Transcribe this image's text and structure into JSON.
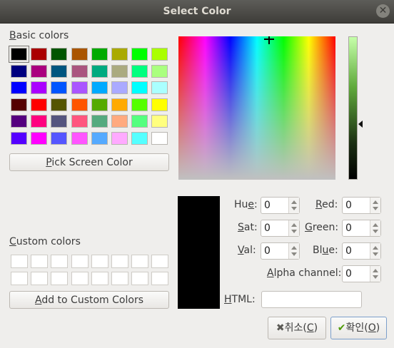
{
  "window": {
    "title": "Select Color"
  },
  "basic": {
    "label_mnemonic": "B",
    "label_rest": "asic colors",
    "swatches": [
      "#000000",
      "#aa0000",
      "#005500",
      "#aa5500",
      "#00aa00",
      "#aaaa00",
      "#00ff00",
      "#aaff00",
      "#00007f",
      "#aa007f",
      "#00557f",
      "#aa557f",
      "#00aa7f",
      "#aaaa7f",
      "#00ff7f",
      "#aaff7f",
      "#0000ff",
      "#aa00ff",
      "#0055ff",
      "#aa55ff",
      "#00aaff",
      "#aaaaff",
      "#00ffff",
      "#aaffff",
      "#550000",
      "#ff0000",
      "#555500",
      "#ff5500",
      "#55aa00",
      "#ffaa00",
      "#55ff00",
      "#ffff00",
      "#55007f",
      "#ff007f",
      "#55557f",
      "#ff557f",
      "#55aa7f",
      "#ffaa7f",
      "#55ff7f",
      "#ffff7f",
      "#5500ff",
      "#ff00ff",
      "#5555ff",
      "#ff55ff",
      "#55aaff",
      "#ffaaff",
      "#55ffff",
      "#ffffff"
    ]
  },
  "pick_button": {
    "mnemonic": "P",
    "rest": "ick Screen Color"
  },
  "custom": {
    "label_mnemonic": "C",
    "label_rest": "ustom colors",
    "slots": 16
  },
  "add_button": {
    "mnemonic": "A",
    "rest": "dd to Custom Colors"
  },
  "current_color": "#000000",
  "fields": {
    "hue": {
      "pre": "Hu",
      "mn": "e",
      "post": ":",
      "value": "0"
    },
    "sat": {
      "pre": "",
      "mn": "S",
      "post": "at:",
      "value": "0"
    },
    "val": {
      "pre": "",
      "mn": "V",
      "post": "al:",
      "value": "0"
    },
    "red": {
      "pre": "",
      "mn": "R",
      "post": "ed:",
      "value": "0"
    },
    "green": {
      "pre": "",
      "mn": "G",
      "post": "reen:",
      "value": "0"
    },
    "blue": {
      "pre": "Bl",
      "mn": "u",
      "post": "e:",
      "value": "0"
    },
    "alpha": {
      "pre": "",
      "mn": "A",
      "post": "lpha channel:",
      "value": "0"
    },
    "html": {
      "pre": "",
      "mn": "H",
      "post": "TML:",
      "value": ""
    }
  },
  "buttons": {
    "cancel": {
      "text": "취소(",
      "mn": "C",
      "close": ")"
    },
    "ok": {
      "text": "확인(",
      "mn": "O",
      "close": ")"
    }
  }
}
